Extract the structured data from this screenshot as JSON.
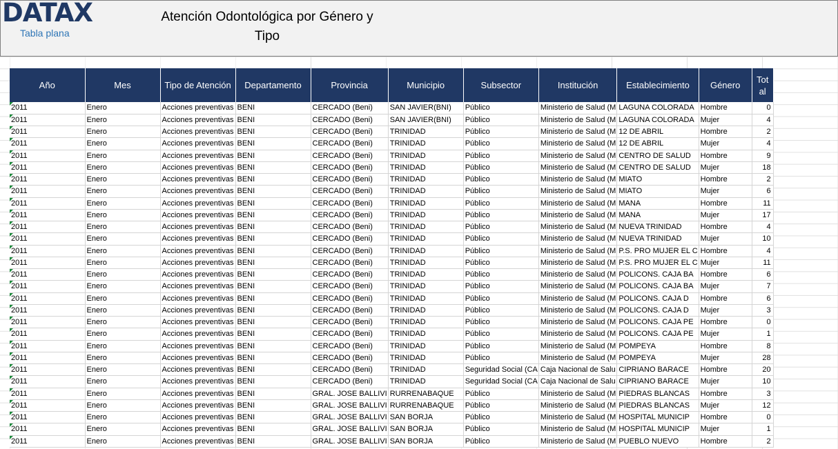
{
  "header": {
    "logo_text": "DATAX",
    "logo_subtitle": "Tabla plana",
    "title": "Atención Odontológica por Género y Tipo"
  },
  "table": {
    "columns": [
      "Año",
      "Mes",
      "Tipo de Atención",
      "Departamento",
      "Provincia",
      "Municipio",
      "Subsector",
      "Institución",
      "Establecimiento",
      "Género",
      "Total"
    ],
    "rows": [
      [
        "2011",
        "Enero",
        "Acciones preventivas",
        "BENI",
        "CERCADO (Beni)",
        "SAN JAVIER(BNI)",
        "Público",
        "Ministerio de Salud (M",
        "LAGUNA COLORADA",
        "Hombre",
        "0"
      ],
      [
        "2011",
        "Enero",
        "Acciones preventivas",
        "BENI",
        "CERCADO (Beni)",
        "SAN JAVIER(BNI)",
        "Público",
        "Ministerio de Salud (M",
        "LAGUNA COLORADA",
        "Mujer",
        "4"
      ],
      [
        "2011",
        "Enero",
        "Acciones preventivas",
        "BENI",
        "CERCADO (Beni)",
        "TRINIDAD",
        "Público",
        "Ministerio de Salud (M",
        "12 DE ABRIL",
        "Hombre",
        "2"
      ],
      [
        "2011",
        "Enero",
        "Acciones preventivas",
        "BENI",
        "CERCADO (Beni)",
        "TRINIDAD",
        "Público",
        "Ministerio de Salud (M",
        "12 DE ABRIL",
        "Mujer",
        "4"
      ],
      [
        "2011",
        "Enero",
        "Acciones preventivas",
        "BENI",
        "CERCADO (Beni)",
        "TRINIDAD",
        "Público",
        "Ministerio de Salud (M",
        "CENTRO DE SALUD",
        "Hombre",
        "9"
      ],
      [
        "2011",
        "Enero",
        "Acciones preventivas",
        "BENI",
        "CERCADO (Beni)",
        "TRINIDAD",
        "Público",
        "Ministerio de Salud (M",
        "CENTRO DE SALUD",
        "Mujer",
        "18"
      ],
      [
        "2011",
        "Enero",
        "Acciones preventivas",
        "BENI",
        "CERCADO (Beni)",
        "TRINIDAD",
        "Público",
        "Ministerio de Salud (M",
        "MIATO",
        "Hombre",
        "2"
      ],
      [
        "2011",
        "Enero",
        "Acciones preventivas",
        "BENI",
        "CERCADO (Beni)",
        "TRINIDAD",
        "Público",
        "Ministerio de Salud (M",
        "MIATO",
        "Mujer",
        "6"
      ],
      [
        "2011",
        "Enero",
        "Acciones preventivas",
        "BENI",
        "CERCADO (Beni)",
        "TRINIDAD",
        "Público",
        "Ministerio de Salud (M",
        "MANA",
        "Hombre",
        "11"
      ],
      [
        "2011",
        "Enero",
        "Acciones preventivas",
        "BENI",
        "CERCADO (Beni)",
        "TRINIDAD",
        "Público",
        "Ministerio de Salud (M",
        "MANA",
        "Mujer",
        "17"
      ],
      [
        "2011",
        "Enero",
        "Acciones preventivas",
        "BENI",
        "CERCADO (Beni)",
        "TRINIDAD",
        "Público",
        "Ministerio de Salud (M",
        "NUEVA TRINIDAD",
        "Hombre",
        "4"
      ],
      [
        "2011",
        "Enero",
        "Acciones preventivas",
        "BENI",
        "CERCADO (Beni)",
        "TRINIDAD",
        "Público",
        "Ministerio de Salud (M",
        "NUEVA TRINIDAD",
        "Mujer",
        "10"
      ],
      [
        "2011",
        "Enero",
        "Acciones preventivas",
        "BENI",
        "CERCADO (Beni)",
        "TRINIDAD",
        "Público",
        "Ministerio de Salud (M",
        "P.S. PRO MUJER EL C",
        "Hombre",
        "4"
      ],
      [
        "2011",
        "Enero",
        "Acciones preventivas",
        "BENI",
        "CERCADO (Beni)",
        "TRINIDAD",
        "Público",
        "Ministerio de Salud (M",
        "P.S. PRO MUJER EL C",
        "Mujer",
        "11"
      ],
      [
        "2011",
        "Enero",
        "Acciones preventivas",
        "BENI",
        "CERCADO (Beni)",
        "TRINIDAD",
        "Público",
        "Ministerio de Salud (M",
        "POLICONS. CAJA BA",
        "Hombre",
        "6"
      ],
      [
        "2011",
        "Enero",
        "Acciones preventivas",
        "BENI",
        "CERCADO (Beni)",
        "TRINIDAD",
        "Público",
        "Ministerio de Salud (M",
        "POLICONS. CAJA BA",
        "Mujer",
        "7"
      ],
      [
        "2011",
        "Enero",
        "Acciones preventivas",
        "BENI",
        "CERCADO (Beni)",
        "TRINIDAD",
        "Público",
        "Ministerio de Salud (M",
        "POLICONS. CAJA D",
        "Hombre",
        "6"
      ],
      [
        "2011",
        "Enero",
        "Acciones preventivas",
        "BENI",
        "CERCADO (Beni)",
        "TRINIDAD",
        "Público",
        "Ministerio de Salud (M",
        "POLICONS. CAJA D",
        "Mujer",
        "3"
      ],
      [
        "2011",
        "Enero",
        "Acciones preventivas",
        "BENI",
        "CERCADO (Beni)",
        "TRINIDAD",
        "Público",
        "Ministerio de Salud (M",
        "POLICONS. CAJA PE",
        "Hombre",
        "0"
      ],
      [
        "2011",
        "Enero",
        "Acciones preventivas",
        "BENI",
        "CERCADO (Beni)",
        "TRINIDAD",
        "Público",
        "Ministerio de Salud (M",
        "POLICONS. CAJA PE",
        "Mujer",
        "1"
      ],
      [
        "2011",
        "Enero",
        "Acciones preventivas",
        "BENI",
        "CERCADO (Beni)",
        "TRINIDAD",
        "Público",
        "Ministerio de Salud (M",
        "POMPEYA",
        "Hombre",
        "8"
      ],
      [
        "2011",
        "Enero",
        "Acciones preventivas",
        "BENI",
        "CERCADO (Beni)",
        "TRINIDAD",
        "Público",
        "Ministerio de Salud (M",
        "POMPEYA",
        "Mujer",
        "28"
      ],
      [
        "2011",
        "Enero",
        "Acciones preventivas",
        "BENI",
        "CERCADO (Beni)",
        "TRINIDAD",
        "Seguridad Social (CA",
        "Caja Nacional de Salu",
        "CIPRIANO BARACE",
        "Hombre",
        "20"
      ],
      [
        "2011",
        "Enero",
        "Acciones preventivas",
        "BENI",
        "CERCADO (Beni)",
        "TRINIDAD",
        "Seguridad Social (CA",
        "Caja Nacional de Salu",
        "CIPRIANO BARACE",
        "Mujer",
        "10"
      ],
      [
        "2011",
        "Enero",
        "Acciones preventivas",
        "BENI",
        "GRAL. JOSE BALLIVI",
        "RURRENABAQUE",
        "Público",
        "Ministerio de Salud (M",
        "PIEDRAS BLANCAS",
        "Hombre",
        "3"
      ],
      [
        "2011",
        "Enero",
        "Acciones preventivas",
        "BENI",
        "GRAL. JOSE BALLIVI",
        "RURRENABAQUE",
        "Público",
        "Ministerio de Salud (M",
        "PIEDRAS BLANCAS",
        "Mujer",
        "12"
      ],
      [
        "2011",
        "Enero",
        "Acciones preventivas",
        "BENI",
        "GRAL. JOSE BALLIVI",
        "SAN BORJA",
        "Público",
        "Ministerio de Salud (M",
        "HOSPITAL MUNICIP",
        "Hombre",
        "0"
      ],
      [
        "2011",
        "Enero",
        "Acciones preventivas",
        "BENI",
        "GRAL. JOSE BALLIVI",
        "SAN BORJA",
        "Público",
        "Ministerio de Salud (M",
        "HOSPITAL MUNICIP",
        "Mujer",
        "1"
      ],
      [
        "2011",
        "Enero",
        "Acciones preventivas",
        "BENI",
        "GRAL. JOSE BALLIVI",
        "SAN BORJA",
        "Público",
        "Ministerio de Salud (M",
        "PUEBLO NUEVO",
        "Hombre",
        "2"
      ]
    ]
  },
  "colors": {
    "header_bg": "#203864",
    "logo": "#1f3864",
    "logo_sub": "#2e75b6",
    "cell_marker": "#1e8a3c"
  }
}
